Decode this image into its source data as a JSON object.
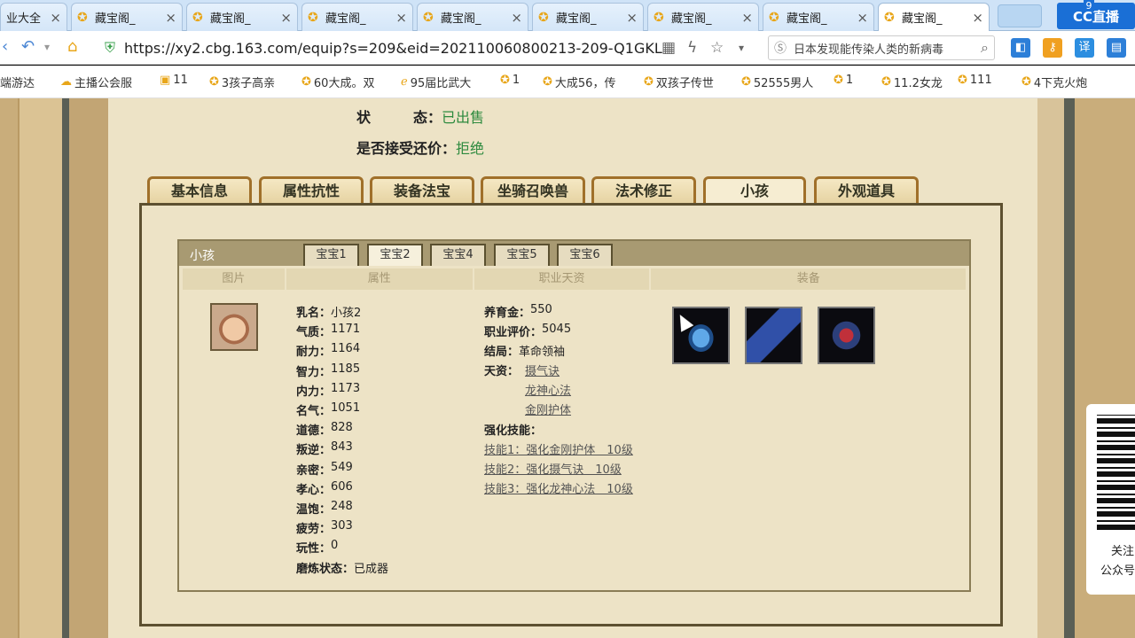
{
  "browser": {
    "tabs": [
      {
        "title": "业大全",
        "active": false
      },
      {
        "title": "藏宝阁_",
        "active": false
      },
      {
        "title": "藏宝阁_",
        "active": false
      },
      {
        "title": "藏宝阁_",
        "active": false
      },
      {
        "title": "藏宝阁_",
        "active": false
      },
      {
        "title": "藏宝阁_",
        "active": false
      },
      {
        "title": "藏宝阁_",
        "active": false
      },
      {
        "title": "藏宝阁_",
        "active": false
      },
      {
        "title": "藏宝阁_",
        "active": true
      }
    ],
    "close_glyph": "×",
    "cc_logo": "CC直播",
    "cc_badge": "9",
    "url": "https://xy2.cbg.163.com/equip?s=209&eid=202110060800213-209-Q1GKL",
    "search_text": "日本发现能传染人类的新病毒",
    "bookmarks": [
      {
        "label": "端游达",
        "icon": "game-icon"
      },
      {
        "label": "主播公会服",
        "icon": "cloud-icon"
      },
      {
        "label": "11",
        "icon": "page-icon"
      },
      {
        "label": "3孩子高亲",
        "icon": "star-icon"
      },
      {
        "label": "60大成。双",
        "icon": "star-icon"
      },
      {
        "label": "95届比武大",
        "icon": "ie-icon"
      },
      {
        "label": "1",
        "icon": "star-icon"
      },
      {
        "label": "大成56，传",
        "icon": "star-icon"
      },
      {
        "label": "双孩子传世",
        "icon": "star-icon"
      },
      {
        "label": "52555男人",
        "icon": "star-icon"
      },
      {
        "label": "1",
        "icon": "star-icon"
      },
      {
        "label": "11.2女龙",
        "icon": "star-icon"
      },
      {
        "label": "111",
        "icon": "star-icon"
      },
      {
        "label": "4下克火炮",
        "icon": "star-icon"
      }
    ]
  },
  "status": {
    "state_label": "状　　　态：",
    "state_value": "已出售",
    "bargain_label": "是否接受还价：",
    "bargain_value": "拒绝"
  },
  "main_tabs": [
    {
      "label": "基本信息",
      "active": false
    },
    {
      "label": "属性抗性",
      "active": false
    },
    {
      "label": "装备法宝",
      "active": false
    },
    {
      "label": "坐骑召唤兽",
      "active": false
    },
    {
      "label": "法术修正",
      "active": false
    },
    {
      "label": "小孩",
      "active": true
    },
    {
      "label": "外观道具",
      "active": false
    }
  ],
  "child_panel": {
    "title": "小孩",
    "baby_tabs": [
      {
        "label": "宝宝1",
        "active": false
      },
      {
        "label": "宝宝2",
        "active": true
      },
      {
        "label": "宝宝4",
        "active": false
      },
      {
        "label": "宝宝5",
        "active": false
      },
      {
        "label": "宝宝6",
        "active": false
      }
    ],
    "columns": [
      "图片",
      "属性",
      "职业天资",
      "装备"
    ],
    "attributes": [
      {
        "k": "乳名：",
        "v": "小孩2"
      },
      {
        "k": "气质：",
        "v": "1171"
      },
      {
        "k": "耐力：",
        "v": "1164"
      },
      {
        "k": "智力：",
        "v": "1185"
      },
      {
        "k": "内力：",
        "v": "1173"
      },
      {
        "k": "名气：",
        "v": "1051"
      },
      {
        "k": "道德：",
        "v": "828"
      },
      {
        "k": "叛逆：",
        "v": "843"
      },
      {
        "k": "亲密：",
        "v": "549"
      },
      {
        "k": "孝心：",
        "v": "606"
      },
      {
        "k": "温饱：",
        "v": "248"
      },
      {
        "k": "疲劳：",
        "v": "303"
      },
      {
        "k": "玩性：",
        "v": "0"
      },
      {
        "k": "磨炼状态：",
        "v": "已成器"
      }
    ],
    "career": {
      "fund_label": "养育金：",
      "fund_value": "550",
      "rating_label": "职业评价：",
      "rating_value": "5045",
      "ending_label": "结局：",
      "ending_value": "革命领袖",
      "talent_label": "天资：",
      "talents": [
        "摄气诀",
        "龙神心法",
        "金刚护体"
      ],
      "skills_label": "强化技能：",
      "skills": [
        "技能1：强化金刚护体　10级",
        "技能2：强化摄气诀　10级",
        "技能3：强化龙神心法　10级"
      ]
    },
    "equipment": [
      "robe-icon",
      "book-icon",
      "chest-icon"
    ]
  },
  "qr_panel": {
    "line1": "关注",
    "line2": "公众号"
  }
}
